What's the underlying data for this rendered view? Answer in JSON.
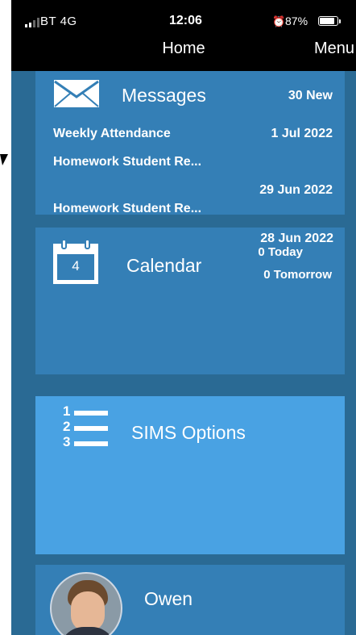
{
  "status_bar": {
    "carrier": "BT 4G",
    "time": "12:06",
    "battery": "87%"
  },
  "nav": {
    "title": "Home",
    "menu_label": "Menu"
  },
  "messages": {
    "title": "Messages",
    "new_count": "30 New",
    "items": [
      {
        "subject": "Weekly Attendance",
        "date": "1 Jul 2022"
      },
      {
        "subject": "Homework Student Re...",
        "date": "29 Jun 2022"
      },
      {
        "subject": "Homework Student Re...",
        "date": ""
      }
    ]
  },
  "calendar": {
    "title": "Calendar",
    "date": "28 Jun 2022",
    "today": "0 Today",
    "tomorrow": "0 Tomorrow",
    "icon_day": "4"
  },
  "sims": {
    "title": "SIMS Options",
    "list_numbers": [
      "1",
      "2",
      "3"
    ]
  },
  "student": {
    "name": "Owen"
  }
}
